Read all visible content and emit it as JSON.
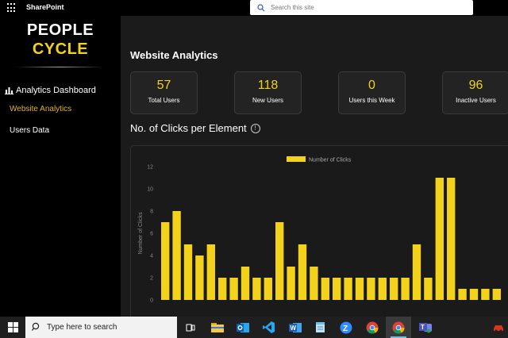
{
  "topbar": {
    "app_name": "SharePoint",
    "search_placeholder": "Search this site"
  },
  "sidebar": {
    "logo_line1": "PEOPLE",
    "logo_line2": "CYCLE",
    "nav_header": "Analytics Dashboard",
    "items": [
      {
        "label": "Website Analytics",
        "active": true
      },
      {
        "label": "Users Data",
        "active": false
      }
    ]
  },
  "main": {
    "title": "Website Analytics",
    "kpis": [
      {
        "value": "57",
        "label": "Total Users"
      },
      {
        "value": "118",
        "label": "New Users"
      },
      {
        "value": "0",
        "label": "Users this Week"
      },
      {
        "value": "96",
        "label": "Inactive Users"
      }
    ],
    "chart_section_title": "No. of Clicks per Element",
    "info_glyph": "!"
  },
  "chart_data": {
    "type": "bar",
    "title": "",
    "legend": "Number of Clicks",
    "legend_position": "top",
    "xlabel": "",
    "ylabel": "Number of Clicks",
    "ylim": [
      0,
      12
    ],
    "yticks": [
      0,
      2,
      4,
      6,
      8,
      10,
      12
    ],
    "grid": false,
    "color": "#f3d21c",
    "values": [
      7,
      8,
      5,
      4,
      5,
      2,
      2,
      3,
      2,
      2,
      7,
      3,
      5,
      3,
      2,
      2,
      2,
      2,
      2,
      2,
      2,
      2,
      5,
      2,
      11,
      11,
      1,
      1,
      1,
      1
    ]
  },
  "taskbar": {
    "search_text": "Type here to search",
    "apps": [
      "task-view",
      "file-explorer",
      "outlook",
      "vscode",
      "word",
      "notepad",
      "zoom",
      "chrome",
      "chrome-active",
      "teams",
      "edge"
    ]
  },
  "colors": {
    "accent": "#f3d21c",
    "nav_active": "#e2b51a",
    "background": "#1b1b1b"
  }
}
